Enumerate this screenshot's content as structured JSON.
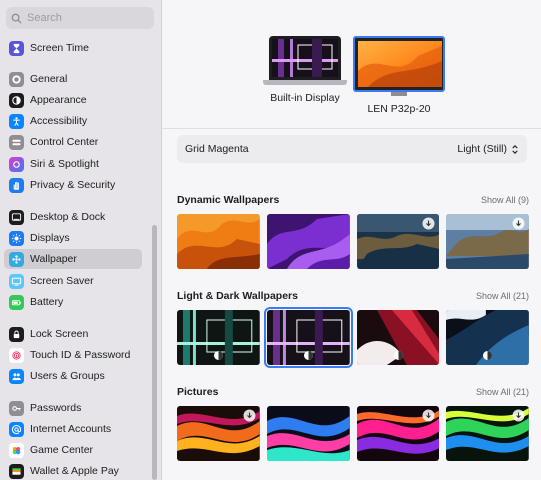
{
  "search": {
    "placeholder": "Search"
  },
  "sidebar": {
    "items": [
      {
        "label": "Screen Time",
        "icon": "hourglass-icon",
        "color": "#5856d6"
      },
      {
        "label": "General",
        "icon": "gear-icon",
        "color": "#8e8e93"
      },
      {
        "label": "Appearance",
        "icon": "appearance-icon",
        "color": "#1c1c1e"
      },
      {
        "label": "Accessibility",
        "icon": "accessibility-icon",
        "color": "#0a84ff"
      },
      {
        "label": "Control Center",
        "icon": "control-center-icon",
        "color": "#8e8e93"
      },
      {
        "label": "Siri & Spotlight",
        "icon": "siri-icon",
        "color": "#2c2c2e"
      },
      {
        "label": "Privacy & Security",
        "icon": "hand-icon",
        "color": "#1e7cf2"
      },
      {
        "label": "Desktop & Dock",
        "icon": "dock-icon",
        "color": "#1c1c1e"
      },
      {
        "label": "Displays",
        "icon": "sun-icon",
        "color": "#1e7cf2"
      },
      {
        "label": "Wallpaper",
        "icon": "wallpaper-icon",
        "color": "#36a9e1"
      },
      {
        "label": "Screen Saver",
        "icon": "screen-saver-icon",
        "color": "#5ac8fa"
      },
      {
        "label": "Battery",
        "icon": "battery-icon",
        "color": "#34c759"
      },
      {
        "label": "Lock Screen",
        "icon": "lock-icon",
        "color": "#1c1c1e"
      },
      {
        "label": "Touch ID & Password",
        "icon": "fingerprint-icon",
        "color": "#ff375f"
      },
      {
        "label": "Users & Groups",
        "icon": "users-icon",
        "color": "#0a84ff"
      },
      {
        "label": "Passwords",
        "icon": "key-icon",
        "color": "#8e8e93"
      },
      {
        "label": "Internet Accounts",
        "icon": "at-icon",
        "color": "#0a84ff"
      },
      {
        "label": "Game Center",
        "icon": "game-center-icon",
        "color": "#ffffff"
      },
      {
        "label": "Wallet & Apple Pay",
        "icon": "wallet-icon",
        "color": "#1c1c1e"
      }
    ],
    "selected": "Wallpaper"
  },
  "displays": {
    "builtin": {
      "label": "Built-in Display"
    },
    "external": {
      "label": "LEN P32p-20",
      "selected": true
    }
  },
  "current_wallpaper": {
    "name": "Grid Magenta",
    "mode": "Light (Still)"
  },
  "sections": {
    "dynamic": {
      "title": "Dynamic Wallpapers",
      "show_all": "Show All (9)",
      "thumbs": [
        "Ventura Orange",
        "Monterey Purple",
        "Catalina Coast",
        "Catalina Island"
      ]
    },
    "light_dark": {
      "title": "Light & Dark Wallpapers",
      "show_all": "Show All (21)",
      "thumbs": [
        "Grid Teal",
        "Grid Magenta",
        "Sweep Red",
        "Sweep Blue"
      ]
    },
    "pictures": {
      "title": "Pictures",
      "show_all": "Show All (21)",
      "thumbs": [
        "Ribbon Orange",
        "Ribbon Blue",
        "Ribbon Magenta",
        "Ribbon Green"
      ]
    }
  },
  "colors": {
    "accent": "#3a7bf5",
    "selection": "#cfcdd2"
  }
}
